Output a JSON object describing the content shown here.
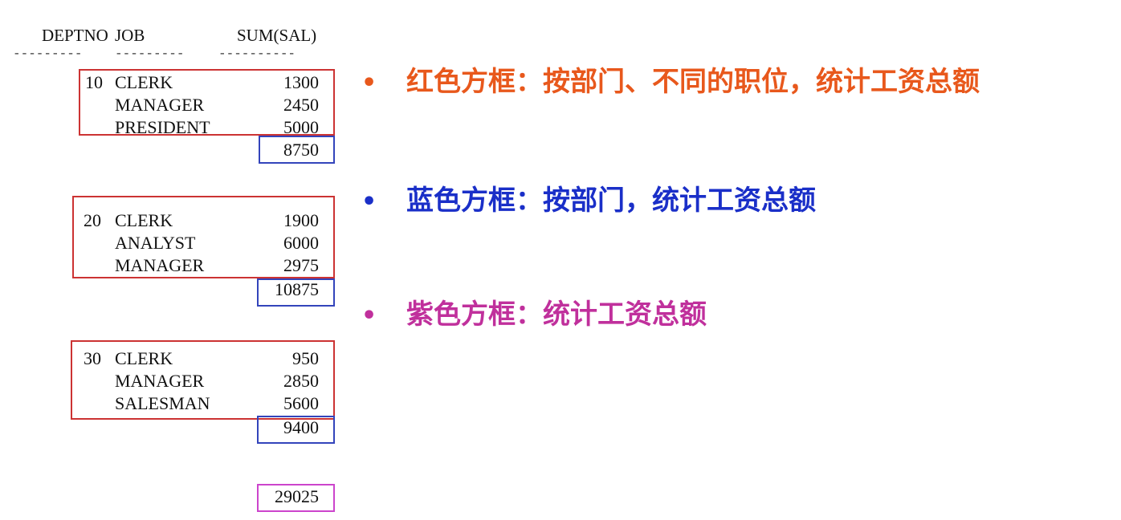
{
  "table": {
    "headers": {
      "deptno": "DEPTNO",
      "job": "JOB",
      "sum": "SUM(SAL)"
    },
    "separators": {
      "deptno": "---------",
      "job": "---------",
      "sum": "----------"
    },
    "groups": [
      {
        "deptno": "10",
        "rows": [
          {
            "job": "CLERK",
            "sum": "1300"
          },
          {
            "job": "MANAGER",
            "sum": "2450"
          },
          {
            "job": "PRESIDENT",
            "sum": "5000"
          }
        ],
        "subtotal": "8750"
      },
      {
        "deptno": "20",
        "rows": [
          {
            "job": "CLERK",
            "sum": "1900"
          },
          {
            "job": "ANALYST",
            "sum": "6000"
          },
          {
            "job": "MANAGER",
            "sum": "2975"
          }
        ],
        "subtotal": "10875"
      },
      {
        "deptno": "30",
        "rows": [
          {
            "job": "CLERK",
            "sum": "950"
          },
          {
            "job": "MANAGER",
            "sum": "2850"
          },
          {
            "job": "SALESMAN",
            "sum": "5600"
          }
        ],
        "subtotal": "9400"
      }
    ],
    "grand_total": "29025"
  },
  "bullets": [
    {
      "marker": "•",
      "text": "红色方框：按部门、不同的职位，统计工资总额",
      "color": "#e8581c"
    },
    {
      "marker": "•",
      "text": "蓝色方框：按部门，统计工资总额",
      "color": "#1a2fc8"
    },
    {
      "marker": "•",
      "text": "紫色方框：统计工资总额",
      "color": "#c0309c"
    }
  ],
  "colors": {
    "red_box": "#cc3333",
    "blue_box": "#3344bb",
    "purple_box": "#cc44cc"
  }
}
